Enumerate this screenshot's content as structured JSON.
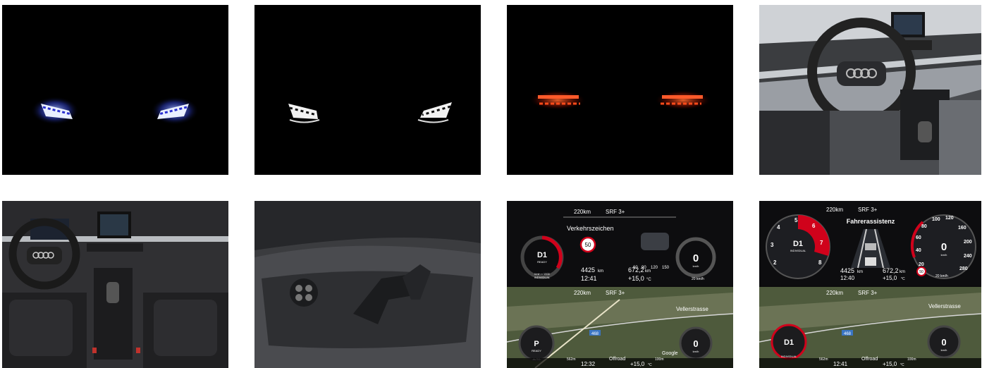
{
  "gallery": {
    "title": "",
    "tiles": [
      {
        "id": "headlights-blue"
      },
      {
        "id": "headlights-white"
      },
      {
        "id": "taillights-red"
      },
      {
        "id": "interior-steering"
      },
      {
        "id": "interior-dashboard"
      },
      {
        "id": "seat-controls"
      },
      {
        "id": "cluster-traffic-signs"
      },
      {
        "id": "cluster-driver-assist"
      }
    ]
  },
  "cluster_signs": {
    "range": "220km",
    "radio": "SRF 3+",
    "headline": "Verkehrszeichen",
    "speed_limit": "50",
    "gear": "D1",
    "gear_mode": "READY",
    "drive_profile": "INDIVIDUAL",
    "consumption_label": "l/min x 1000",
    "odometer": "4425",
    "odometer_unit": "km",
    "trip": "672,2",
    "trip_unit": "km",
    "time": "12:41",
    "temperature": "+15,0",
    "temp_unit": "°C",
    "speed": "0",
    "speed_unit": "km/h",
    "set_speed": "20 km/h",
    "ticks": [
      "60",
      "90",
      "120",
      "150"
    ]
  },
  "map_signs": {
    "range": "220km",
    "radio": "SRF 3+",
    "gear": "P",
    "gear_mode": "READY",
    "drive_profile": "AUTO",
    "street": "Vellerstrasse",
    "road_badge": "468",
    "distance": "562m",
    "scale": "100m",
    "time": "12:32",
    "temperature": "+15,0",
    "temp_unit": "°C",
    "speed": "0",
    "speed_unit": "km/h",
    "provider": "Google"
  },
  "cluster_assist": {
    "range": "220km",
    "radio": "SRF 3+",
    "headline": "Fahrerassistenz",
    "gear": "D1",
    "drive_profile": "INDIVIDUAL",
    "odometer": "4425",
    "odometer_unit": "km",
    "trip": "672,2",
    "trip_unit": "km",
    "time": "12:40",
    "temperature": "+15,0",
    "temp_unit": "°C",
    "speed": "0",
    "speed_unit": "km/h",
    "rpm_ticks": [
      "2",
      "3",
      "4",
      "5",
      "6",
      "7",
      "8"
    ],
    "speed_ticks": [
      "20",
      "40",
      "60",
      "80",
      "100",
      "120",
      "160",
      "200",
      "240",
      "280"
    ],
    "set_speed": "20 km/h",
    "limit_badge": "50"
  },
  "map_assist": {
    "range": "220km",
    "radio": "SRF 3+",
    "gear": "D1",
    "drive_profile": "INDIVIDUAL",
    "street": "Vellerstrasse",
    "road_badge": "468",
    "distance": "562m",
    "mode": "Offroad",
    "scale": "100m",
    "time": "12:41",
    "temperature": "+15,0",
    "temp_unit": "°C",
    "speed": "0",
    "speed_unit": "km/h"
  },
  "map_signs_mode": "Offroad"
}
